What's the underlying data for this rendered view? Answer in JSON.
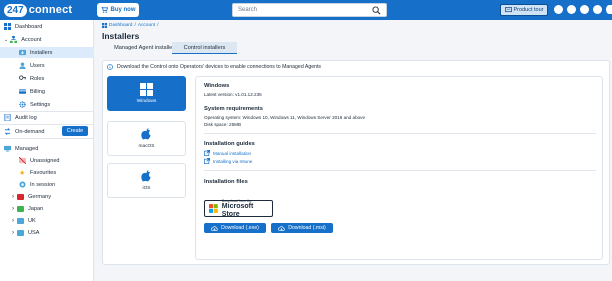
{
  "topbar": {
    "logo_num": "247",
    "logo_text": "connect",
    "buy_now": "Buy now",
    "search_placeholder": "Search",
    "product_tour": "Product tour",
    "brand_color": "#1670c9"
  },
  "sidebar": {
    "dashboard": "Dashboard",
    "account": "Account",
    "installers": "Installers",
    "users": "Users",
    "roles": "Roles",
    "billing": "Billing",
    "settings": "Settings",
    "audit_log": "Audit log",
    "on_demand": "On-demand",
    "create": "Create",
    "managed": "Managed",
    "unassigned": "Unassigned",
    "favourites": "Favourites",
    "in_session": "In session",
    "groups": [
      {
        "label": "Germany",
        "color": "#d9262c"
      },
      {
        "label": "Japan",
        "color": "#3fb34f"
      },
      {
        "label": "UK",
        "color": "#4aa7d8"
      },
      {
        "label": "USA",
        "color": "#4aa7d8"
      }
    ]
  },
  "main": {
    "breadcrumb_1": "Dashboard",
    "breadcrumb_2": "Account",
    "breadcrumb_sep": "/",
    "title": "Installers",
    "tab_1": "Managed Agent installers",
    "tab_2": "Control installers",
    "info": "Download the Control onto Operators' devices to enable connections to Managed Agents",
    "os_cards": [
      {
        "label": "Windows",
        "icon": "windows-icon"
      },
      {
        "label": "macOS",
        "icon": "apple-icon"
      },
      {
        "label": "iOS",
        "icon": "apple-icon"
      }
    ],
    "detail": {
      "os_name": "Windows",
      "version": "Latest version: v1.01.12.235",
      "req_title": "System requirements",
      "req_os": "Operating system: Windows 10, Windows 11, Windows Server 2016 and above",
      "req_disk": "Disk space: 25MB",
      "guides_title": "Installation guides",
      "guide_1": "Manual installation",
      "guide_2": "Installing via Intune",
      "files_title": "Installation files",
      "store_small": "Download from the",
      "store_big": "Microsoft Store",
      "dl_exe": "Download (.exe)",
      "dl_msi": "Download (.msi)"
    }
  }
}
